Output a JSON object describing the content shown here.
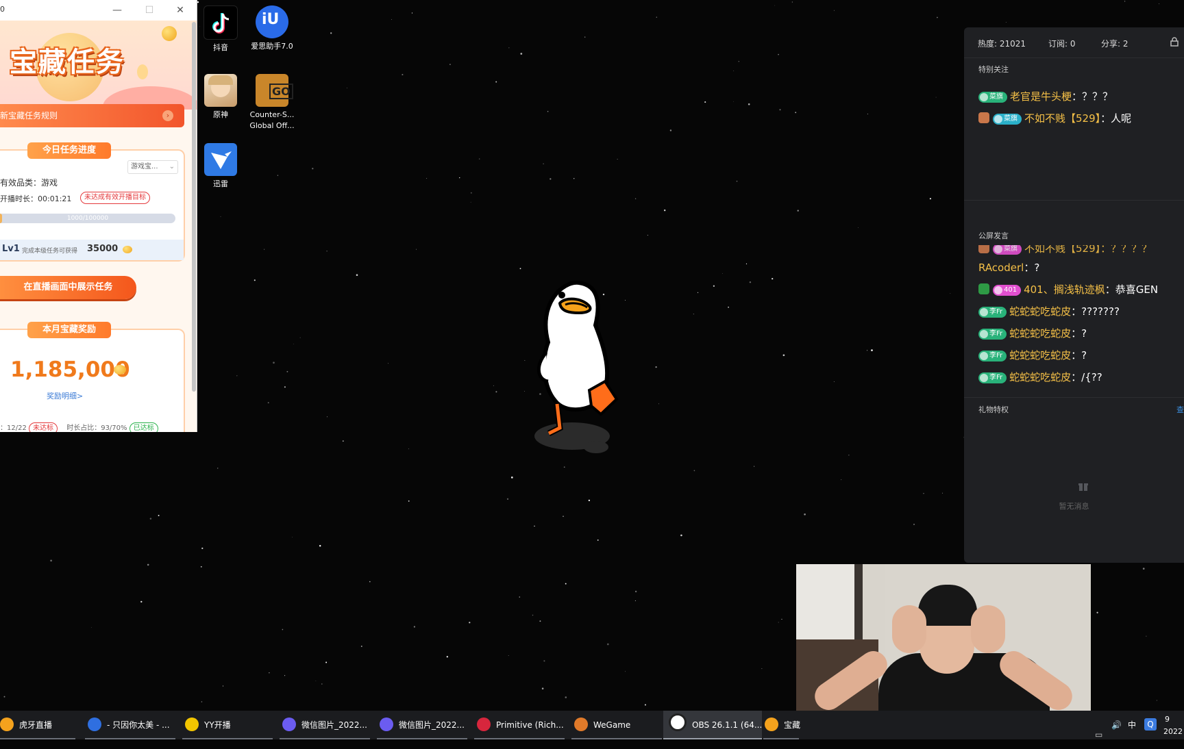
{
  "task_window": {
    "title_fragment": "0",
    "controls": {
      "minimize": "—",
      "maximize": "☐",
      "close": "✕"
    },
    "logo": "宝藏任务",
    "rules_link": "新宝藏任务规则",
    "today_card": {
      "tag": "今日任务进度",
      "dropdown": "游戏宝...",
      "category_label": "有效品类：游戏",
      "duration_label": "开播时长：00:01:21",
      "duration_status": "未达成有效开播目标",
      "progress_text": "1000/100000",
      "progress_fraction": 0.01,
      "level": "Lv1",
      "level_note": "完成本级任务可获得",
      "level_reward": "35000"
    },
    "show_button": "在直播画面中展示任务",
    "month_card": {
      "tag": "本月宝藏奖励",
      "amount": "1,185,000",
      "details_link": "奖励明细>",
      "bottom_left": "：12/22",
      "bottom_left_status": "未达标",
      "bottom_right": "时长占比：93/70%",
      "bottom_right_status": "已达标"
    }
  },
  "desktop_icons": [
    {
      "name": "douyin-icon",
      "label": "抖音"
    },
    {
      "name": "aisi-icon",
      "label": "爱思助手7.0"
    },
    {
      "name": "genshin-icon",
      "label": "原神"
    },
    {
      "name": "csgo-icon",
      "label": "Counter-S...",
      "label2": "Global Off..."
    },
    {
      "name": "xunlei-icon",
      "label": "迅雷"
    }
  ],
  "live_panel": {
    "stats": {
      "heat": "热度: 21021",
      "subs": "订阅: 0",
      "shares": "分享: 2"
    },
    "special_title": "特别关注",
    "special_msgs": [
      {
        "badge": "菜旗",
        "nick": "老官是牛头梗",
        "text": "？？？"
      },
      {
        "badge": "菜旗",
        "nick": "不如不贱【529】",
        "text": "人呢"
      }
    ],
    "public_title": "公屏发言",
    "public_partial": "不如不贱【529】：？？？？",
    "public_partial_badge": "菜旗",
    "public_msgs": [
      {
        "badge": "",
        "nick": "RAcoderl",
        "text": "?"
      },
      {
        "badge": "401",
        "nick": "401、搁浅轨迹枫",
        "text": "恭喜GEN"
      },
      {
        "badge": "李Fr",
        "nick": "蛇蛇蛇吃蛇皮",
        "text": "???????"
      },
      {
        "badge": "李Fr",
        "nick": "蛇蛇蛇吃蛇皮",
        "text": "?"
      },
      {
        "badge": "李Fr",
        "nick": "蛇蛇蛇吃蛇皮",
        "text": "?"
      },
      {
        "badge": "李Fr",
        "nick": "蛇蛇蛇吃蛇皮",
        "text": "/{??"
      }
    ],
    "gift_title": "礼物特权",
    "gift_more": "查",
    "gift_empty": "暂无消息",
    "sep": "："
  },
  "taskbar": {
    "items": [
      {
        "label": "虎牙直播",
        "color": "#f4a21d"
      },
      {
        "label": "- 只因你太美 - ...",
        "color": "#2f6fe0"
      },
      {
        "label": "YY开播",
        "color": "#f2c500"
      },
      {
        "label": "微信图片_2022...",
        "color": "#6b5cf0"
      },
      {
        "label": "微信图片_2022...",
        "color": "#6b5cf0"
      },
      {
        "label": "Primitive (Rich...",
        "color": "#d7263d"
      },
      {
        "label": "WeGame",
        "color": "#e07a2a"
      },
      {
        "label": "OBS 26.1.1 (64...",
        "color": "#ffffff"
      },
      {
        "label": "宝藏",
        "color": "#f4a21d"
      }
    ],
    "tray": {
      "ime": "中",
      "clock_top": "9",
      "clock_bottom": "2022"
    }
  }
}
